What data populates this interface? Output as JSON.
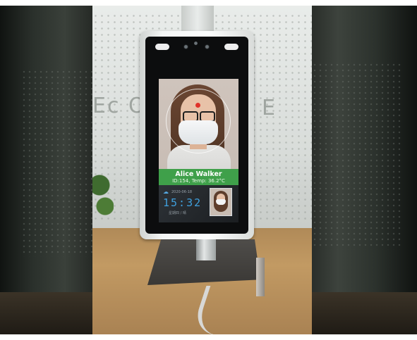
{
  "scene": {
    "description_tag": "face-recognition-thermometer-kiosk"
  },
  "screen": {
    "person_name": "Alice Walker",
    "details": "ID:154, Temp: 36.2°C",
    "clock_time": "15:32",
    "date_text": "2020-06-18",
    "weekday_text": "星期四 / 晴",
    "weather_icon": "cloud-icon"
  },
  "background": {
    "glass_text_left": "Ec OF",
    "glass_text_right": "E"
  },
  "colors": {
    "id_bar": "#3fa04a",
    "clock": "#3fa0de",
    "temperature_dot": "#e0322a"
  }
}
